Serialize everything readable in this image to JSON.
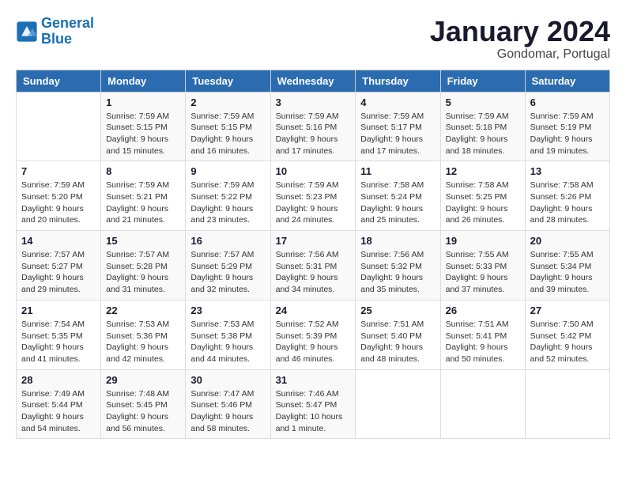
{
  "header": {
    "logo_line1": "General",
    "logo_line2": "Blue",
    "title": "January 2024",
    "subtitle": "Gondomar, Portugal"
  },
  "weekdays": [
    "Sunday",
    "Monday",
    "Tuesday",
    "Wednesday",
    "Thursday",
    "Friday",
    "Saturday"
  ],
  "weeks": [
    [
      {
        "day": "",
        "sunrise": "",
        "sunset": "",
        "daylight": ""
      },
      {
        "day": "1",
        "sunrise": "Sunrise: 7:59 AM",
        "sunset": "Sunset: 5:15 PM",
        "daylight": "Daylight: 9 hours and 15 minutes."
      },
      {
        "day": "2",
        "sunrise": "Sunrise: 7:59 AM",
        "sunset": "Sunset: 5:15 PM",
        "daylight": "Daylight: 9 hours and 16 minutes."
      },
      {
        "day": "3",
        "sunrise": "Sunrise: 7:59 AM",
        "sunset": "Sunset: 5:16 PM",
        "daylight": "Daylight: 9 hours and 17 minutes."
      },
      {
        "day": "4",
        "sunrise": "Sunrise: 7:59 AM",
        "sunset": "Sunset: 5:17 PM",
        "daylight": "Daylight: 9 hours and 17 minutes."
      },
      {
        "day": "5",
        "sunrise": "Sunrise: 7:59 AM",
        "sunset": "Sunset: 5:18 PM",
        "daylight": "Daylight: 9 hours and 18 minutes."
      },
      {
        "day": "6",
        "sunrise": "Sunrise: 7:59 AM",
        "sunset": "Sunset: 5:19 PM",
        "daylight": "Daylight: 9 hours and 19 minutes."
      }
    ],
    [
      {
        "day": "7",
        "sunrise": "Sunrise: 7:59 AM",
        "sunset": "Sunset: 5:20 PM",
        "daylight": "Daylight: 9 hours and 20 minutes."
      },
      {
        "day": "8",
        "sunrise": "Sunrise: 7:59 AM",
        "sunset": "Sunset: 5:21 PM",
        "daylight": "Daylight: 9 hours and 21 minutes."
      },
      {
        "day": "9",
        "sunrise": "Sunrise: 7:59 AM",
        "sunset": "Sunset: 5:22 PM",
        "daylight": "Daylight: 9 hours and 23 minutes."
      },
      {
        "day": "10",
        "sunrise": "Sunrise: 7:59 AM",
        "sunset": "Sunset: 5:23 PM",
        "daylight": "Daylight: 9 hours and 24 minutes."
      },
      {
        "day": "11",
        "sunrise": "Sunrise: 7:58 AM",
        "sunset": "Sunset: 5:24 PM",
        "daylight": "Daylight: 9 hours and 25 minutes."
      },
      {
        "day": "12",
        "sunrise": "Sunrise: 7:58 AM",
        "sunset": "Sunset: 5:25 PM",
        "daylight": "Daylight: 9 hours and 26 minutes."
      },
      {
        "day": "13",
        "sunrise": "Sunrise: 7:58 AM",
        "sunset": "Sunset: 5:26 PM",
        "daylight": "Daylight: 9 hours and 28 minutes."
      }
    ],
    [
      {
        "day": "14",
        "sunrise": "Sunrise: 7:57 AM",
        "sunset": "Sunset: 5:27 PM",
        "daylight": "Daylight: 9 hours and 29 minutes."
      },
      {
        "day": "15",
        "sunrise": "Sunrise: 7:57 AM",
        "sunset": "Sunset: 5:28 PM",
        "daylight": "Daylight: 9 hours and 31 minutes."
      },
      {
        "day": "16",
        "sunrise": "Sunrise: 7:57 AM",
        "sunset": "Sunset: 5:29 PM",
        "daylight": "Daylight: 9 hours and 32 minutes."
      },
      {
        "day": "17",
        "sunrise": "Sunrise: 7:56 AM",
        "sunset": "Sunset: 5:31 PM",
        "daylight": "Daylight: 9 hours and 34 minutes."
      },
      {
        "day": "18",
        "sunrise": "Sunrise: 7:56 AM",
        "sunset": "Sunset: 5:32 PM",
        "daylight": "Daylight: 9 hours and 35 minutes."
      },
      {
        "day": "19",
        "sunrise": "Sunrise: 7:55 AM",
        "sunset": "Sunset: 5:33 PM",
        "daylight": "Daylight: 9 hours and 37 minutes."
      },
      {
        "day": "20",
        "sunrise": "Sunrise: 7:55 AM",
        "sunset": "Sunset: 5:34 PM",
        "daylight": "Daylight: 9 hours and 39 minutes."
      }
    ],
    [
      {
        "day": "21",
        "sunrise": "Sunrise: 7:54 AM",
        "sunset": "Sunset: 5:35 PM",
        "daylight": "Daylight: 9 hours and 41 minutes."
      },
      {
        "day": "22",
        "sunrise": "Sunrise: 7:53 AM",
        "sunset": "Sunset: 5:36 PM",
        "daylight": "Daylight: 9 hours and 42 minutes."
      },
      {
        "day": "23",
        "sunrise": "Sunrise: 7:53 AM",
        "sunset": "Sunset: 5:38 PM",
        "daylight": "Daylight: 9 hours and 44 minutes."
      },
      {
        "day": "24",
        "sunrise": "Sunrise: 7:52 AM",
        "sunset": "Sunset: 5:39 PM",
        "daylight": "Daylight: 9 hours and 46 minutes."
      },
      {
        "day": "25",
        "sunrise": "Sunrise: 7:51 AM",
        "sunset": "Sunset: 5:40 PM",
        "daylight": "Daylight: 9 hours and 48 minutes."
      },
      {
        "day": "26",
        "sunrise": "Sunrise: 7:51 AM",
        "sunset": "Sunset: 5:41 PM",
        "daylight": "Daylight: 9 hours and 50 minutes."
      },
      {
        "day": "27",
        "sunrise": "Sunrise: 7:50 AM",
        "sunset": "Sunset: 5:42 PM",
        "daylight": "Daylight: 9 hours and 52 minutes."
      }
    ],
    [
      {
        "day": "28",
        "sunrise": "Sunrise: 7:49 AM",
        "sunset": "Sunset: 5:44 PM",
        "daylight": "Daylight: 9 hours and 54 minutes."
      },
      {
        "day": "29",
        "sunrise": "Sunrise: 7:48 AM",
        "sunset": "Sunset: 5:45 PM",
        "daylight": "Daylight: 9 hours and 56 minutes."
      },
      {
        "day": "30",
        "sunrise": "Sunrise: 7:47 AM",
        "sunset": "Sunset: 5:46 PM",
        "daylight": "Daylight: 9 hours and 58 minutes."
      },
      {
        "day": "31",
        "sunrise": "Sunrise: 7:46 AM",
        "sunset": "Sunset: 5:47 PM",
        "daylight": "Daylight: 10 hours and 1 minute."
      },
      {
        "day": "",
        "sunrise": "",
        "sunset": "",
        "daylight": ""
      },
      {
        "day": "",
        "sunrise": "",
        "sunset": "",
        "daylight": ""
      },
      {
        "day": "",
        "sunrise": "",
        "sunset": "",
        "daylight": ""
      }
    ]
  ]
}
